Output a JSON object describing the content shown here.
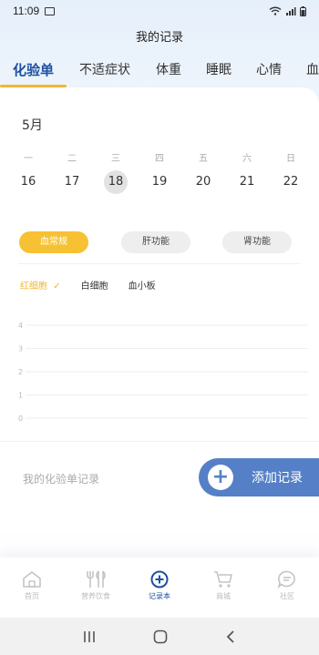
{
  "status": {
    "time": "11:09"
  },
  "header": {
    "title": "我的记录"
  },
  "tabs": [
    {
      "label": "化验单",
      "active": true
    },
    {
      "label": "不适症状",
      "active": false
    },
    {
      "label": "体重",
      "active": false
    },
    {
      "label": "睡眠",
      "active": false
    },
    {
      "label": "心情",
      "active": false
    },
    {
      "label": "血压",
      "active": false
    }
  ],
  "calendar": {
    "month": "5月",
    "weekdays": [
      "一",
      "二",
      "三",
      "四",
      "五",
      "六",
      "日"
    ],
    "dates": [
      "16",
      "17",
      "18",
      "19",
      "20",
      "21",
      "22"
    ],
    "selected_date": "18"
  },
  "categories": [
    {
      "label": "血常规",
      "active": true
    },
    {
      "label": "肝功能",
      "active": false
    },
    {
      "label": "肾功能",
      "active": false
    }
  ],
  "sub_items": [
    {
      "label": "红细胞",
      "active": true,
      "check": "✓"
    },
    {
      "label": "白细胞",
      "active": false
    },
    {
      "label": "血小板",
      "active": false
    }
  ],
  "chart_data": {
    "type": "line",
    "y_ticks": [
      "4",
      "3",
      "2",
      "1",
      "0"
    ],
    "series": [],
    "grid": true
  },
  "records": {
    "label": "我的化验单记录",
    "add_button": "添加记录",
    "add_icon": "+"
  },
  "bottom_nav": [
    {
      "label": "首页",
      "icon": "home-icon",
      "active": false
    },
    {
      "label": "营养饮食",
      "icon": "fork-knife-icon",
      "active": false
    },
    {
      "label": "记录本",
      "icon": "plus-circle-icon",
      "active": true
    },
    {
      "label": "商城",
      "icon": "cart-icon",
      "active": false
    },
    {
      "label": "社区",
      "icon": "chat-icon",
      "active": false
    }
  ],
  "colors": {
    "accent_blue": "#1f4fa0",
    "accent_yellow": "#f2b731",
    "button_blue": "#5580c7"
  }
}
